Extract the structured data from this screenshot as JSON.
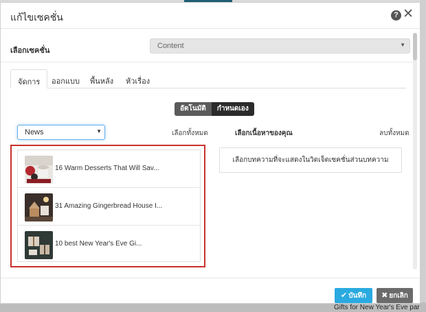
{
  "background": {
    "bottom_text": "Gifts for New Year's Eve par"
  },
  "modal": {
    "title": "แก้ไขเซคชั่น",
    "help_icon": "question-circle-icon",
    "close_icon": "close-icon",
    "section_label": "เลือกเซคชั่น",
    "section_value": "Content"
  },
  "tabs": [
    {
      "label": "จัดการ",
      "active": true
    },
    {
      "label": "ออกแบบ",
      "active": false
    },
    {
      "label": "พื้นหลัง",
      "active": false
    },
    {
      "label": "หัวเรื่อง",
      "active": false
    }
  ],
  "mode_toggle": {
    "auto": "อัตโนมัติ",
    "manual": "กำหนดเอง",
    "selected": "manual"
  },
  "category": {
    "value": "News"
  },
  "labels": {
    "select_all": "เลือกทั้งหมด",
    "your_content": "เลือกเนื้อหาของคุณ",
    "clear_all": "ลบทั้งหมด"
  },
  "articles": [
    {
      "title": "16 Warm Desserts That Will Sav..."
    },
    {
      "title": "31 Amazing Gingerbread House I..."
    },
    {
      "title": "10 best New Year's Eve Gi..."
    }
  ],
  "selected_placeholder": "เลือกบทความที่จะแสดงในวิดเจ็ตเซคชั่นส่วนบทความ",
  "footer": {
    "save": "บันทึก",
    "cancel": "ยกเลิก"
  },
  "colors": {
    "primary": "#2aaae0",
    "highlight_frame": "#c9302c",
    "cancel": "#6b6b6b"
  }
}
